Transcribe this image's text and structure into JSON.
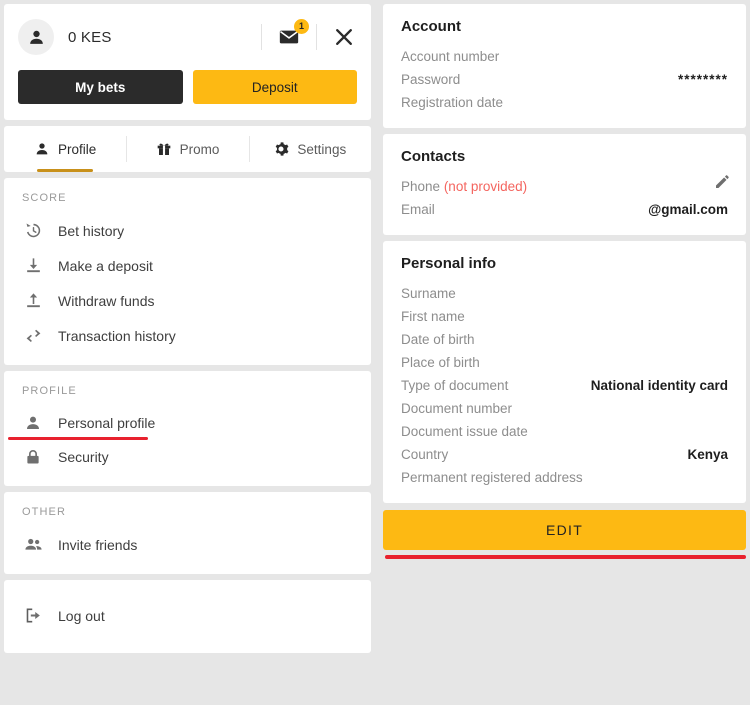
{
  "header": {
    "balance": "0 KES",
    "avatar_icon": "person-icon",
    "mail_icon": "mail-icon",
    "mail_badge": "1",
    "close_icon": "close-icon",
    "my_bets_label": "My bets",
    "deposit_label": "Deposit"
  },
  "tabs": [
    {
      "label": "Profile",
      "icon": "person-icon",
      "active": true
    },
    {
      "label": "Promo",
      "icon": "gift-icon",
      "active": false
    },
    {
      "label": "Settings",
      "icon": "gear-icon",
      "active": false
    }
  ],
  "sidebar": {
    "groups": [
      {
        "title": "SCORE",
        "items": [
          {
            "label": "Bet history",
            "icon": "history-icon"
          },
          {
            "label": "Make a deposit",
            "icon": "download-icon"
          },
          {
            "label": "Withdraw funds",
            "icon": "upload-icon"
          },
          {
            "label": "Transaction history",
            "icon": "transfer-icon"
          }
        ]
      },
      {
        "title": "PROFILE",
        "items": [
          {
            "label": "Personal profile",
            "icon": "person-icon",
            "annotated": true
          },
          {
            "label": "Security",
            "icon": "lock-icon"
          }
        ]
      },
      {
        "title": "OTHER",
        "items": [
          {
            "label": "Invite friends",
            "icon": "people-icon"
          }
        ]
      }
    ],
    "logout": {
      "label": "Log out",
      "icon": "logout-icon"
    }
  },
  "account": {
    "title": "Account",
    "rows": [
      {
        "label": "Account number",
        "value": ""
      },
      {
        "label": "Password",
        "value": "********"
      },
      {
        "label": "Registration date",
        "value": ""
      }
    ]
  },
  "contacts": {
    "title": "Contacts",
    "phone_label": "Phone",
    "phone_status": "(not provided)",
    "email_label": "Email",
    "email_value": "@gmail.com",
    "edit_icon": "pencil-icon"
  },
  "personal_info": {
    "title": "Personal info",
    "rows": [
      {
        "label": "Surname",
        "value": ""
      },
      {
        "label": "First name",
        "value": ""
      },
      {
        "label": "Date of birth",
        "value": ""
      },
      {
        "label": "Place of birth",
        "value": ""
      },
      {
        "label": "Type of document",
        "value": "National identity card"
      },
      {
        "label": "Document number",
        "value": ""
      },
      {
        "label": "Document issue date",
        "value": ""
      },
      {
        "label": "Country",
        "value": "Kenya"
      },
      {
        "label": "Permanent registered address",
        "value": ""
      }
    ]
  },
  "edit_button": {
    "label": "EDIT"
  },
  "colors": {
    "accent": "#FDB913",
    "dark": "#2b2b2b",
    "annotation_red": "#E8212E",
    "muted_red": "#F4655F",
    "background": "#e6e6e6"
  }
}
